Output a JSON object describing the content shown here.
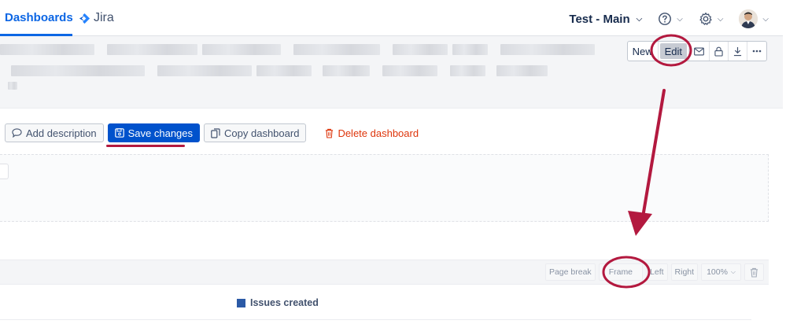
{
  "nav": {
    "dashboards_tab": "Dashboards",
    "jira_label": "Jira",
    "project_label": "Test - Main",
    "help_icon": "question-circle-icon",
    "settings_icon": "gear-icon",
    "accent": "#0c66e4"
  },
  "toolbar": {
    "new_label": "New",
    "edit_label": "Edit",
    "email_icon": "envelope-icon",
    "lock_icon": "lock-icon",
    "download_icon": "download-icon",
    "more_icon": "ellipsis-icon"
  },
  "actions": {
    "add_description": "Add description",
    "save_changes": "Save changes",
    "copy_dashboard": "Copy dashboard",
    "delete_dashboard": "Delete dashboard",
    "primary_color": "#0052cc",
    "danger_color": "#de350b"
  },
  "widget_tools": {
    "page_break": "Page break",
    "frame": "Frame",
    "left": "Left",
    "right": "Right",
    "zoom": "100%",
    "delete_icon": "trash-icon"
  },
  "legend": {
    "series_label": "Issues created",
    "series_color": "#2b5aa6"
  },
  "annotation_color": "#b3193f"
}
